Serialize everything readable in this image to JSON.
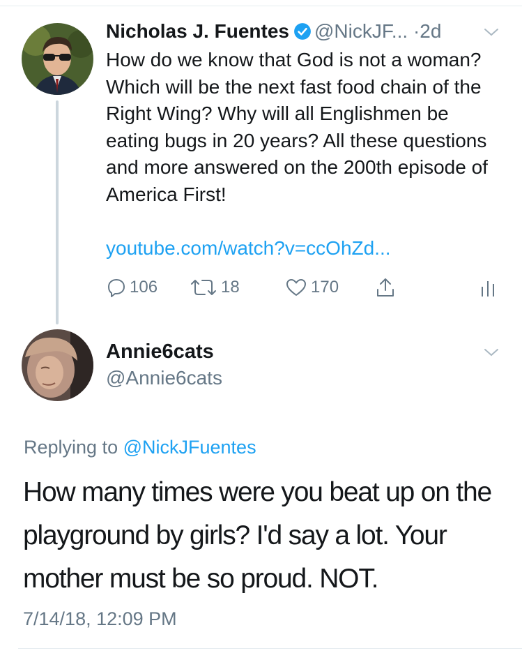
{
  "tweet": {
    "author_name": "Nicholas J. Fuentes",
    "verified_icon": "verified-badge-icon",
    "handle": "@NickJF...",
    "dot": "·",
    "time": "2d",
    "text": "How do we know that God is not a woman? Which will be the next fast food chain of the Right Wing? Why will all Englishmen be eating bugs in 20 years? All these questions and more answered on the 200th episode of America First!",
    "link": "youtube.com/watch?v=ccOhZd...",
    "actions": {
      "replies": "106",
      "retweets": "18",
      "likes": "170"
    }
  },
  "reply": {
    "author_name": "Annie6cats",
    "handle": "@Annie6cats",
    "replying_prefix": "Replying to",
    "replying_handle": "@NickJFuentes",
    "text": "How many times were you beat up on the playground by girls? I'd say a lot. Your mother must be so proud. NOT.",
    "timestamp": "7/14/18, 12:09 PM"
  },
  "colors": {
    "link_blue": "#1da1f2",
    "secondary_gray": "#657786",
    "primary_text": "#14171a",
    "divider": "#e6ecf0",
    "thread_line": "#ccd6dd"
  }
}
